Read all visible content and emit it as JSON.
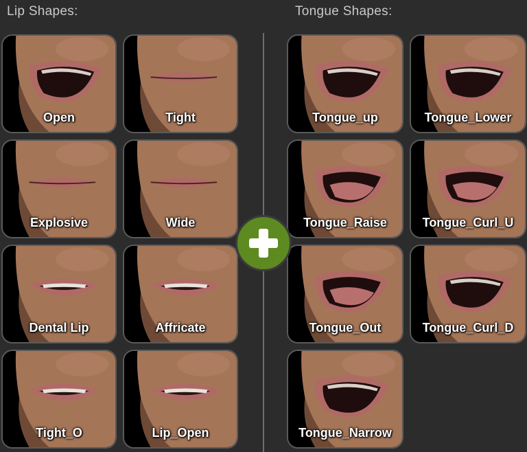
{
  "lip_section": {
    "title": "Lip Shapes:",
    "items": [
      {
        "label": "Open",
        "mouth": "open"
      },
      {
        "label": "Tight",
        "mouth": "closed"
      },
      {
        "label": "Explosive",
        "mouth": "closed"
      },
      {
        "label": "Wide",
        "mouth": "closed"
      },
      {
        "label": "Dental Lip",
        "mouth": "teeth"
      },
      {
        "label": "Affricate",
        "mouth": "teeth"
      },
      {
        "label": "Tight_O",
        "mouth": "teeth"
      },
      {
        "label": "Lip_Open",
        "mouth": "teeth"
      }
    ]
  },
  "tongue_section": {
    "title": "Tongue Shapes:",
    "items": [
      {
        "label": "Tongue_up",
        "mouth": "open"
      },
      {
        "label": "Tongue_Lower",
        "mouth": "open"
      },
      {
        "label": "Tongue_Raise",
        "mouth": "tongue"
      },
      {
        "label": "Tongue_Curl_U",
        "mouth": "tongue"
      },
      {
        "label": "Tongue_Out",
        "mouth": "tongue"
      },
      {
        "label": "Tongue_Curl_D",
        "mouth": "open"
      },
      {
        "label": "Tongue_Narrow",
        "mouth": "open"
      }
    ]
  },
  "add_button": {
    "icon": "plus-icon",
    "color": "#5e8a22"
  },
  "colors": {
    "background": "#2c2c2c",
    "skin": "#a57558",
    "lips": "#b06a66"
  }
}
